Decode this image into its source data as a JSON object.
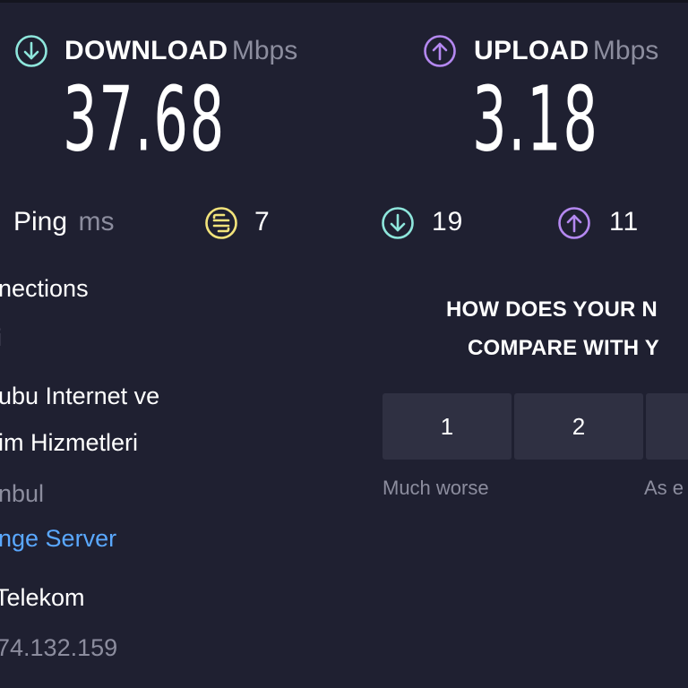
{
  "download": {
    "label": "DOWNLOAD",
    "unit": "Mbps",
    "value": "37.68",
    "icon": "download-arrow-icon",
    "color": "#8ee6dc"
  },
  "upload": {
    "label": "UPLOAD",
    "unit": "Mbps",
    "value": "3.18",
    "icon": "upload-arrow-icon",
    "color": "#b488f0"
  },
  "ping": {
    "label": "Ping",
    "unit": "ms",
    "idle": {
      "icon": "ping-idle-icon",
      "value": "7",
      "color": "#f2e37b"
    },
    "download": {
      "icon": "ping-download-icon",
      "value": "19",
      "color": "#8ee6dc"
    },
    "upload": {
      "icon": "ping-upload-icon",
      "value": "11",
      "color": "#b488f0"
    }
  },
  "connection_info": {
    "connections_label": "nections",
    "connections_value": "i",
    "isp_line1": "ubu Internet ve",
    "isp_line2": "im Hizmetleri",
    "server_location": "nbul",
    "change_server_link": "nge Server",
    "host_name": "Telekom",
    "ip_address": "74.132.159"
  },
  "survey": {
    "question_line1": "HOW DOES YOUR N",
    "question_line2": "COMPARE WITH Y",
    "ratings": [
      "1",
      "2",
      ""
    ],
    "caption_low": "Much worse",
    "caption_mid": "As e"
  }
}
